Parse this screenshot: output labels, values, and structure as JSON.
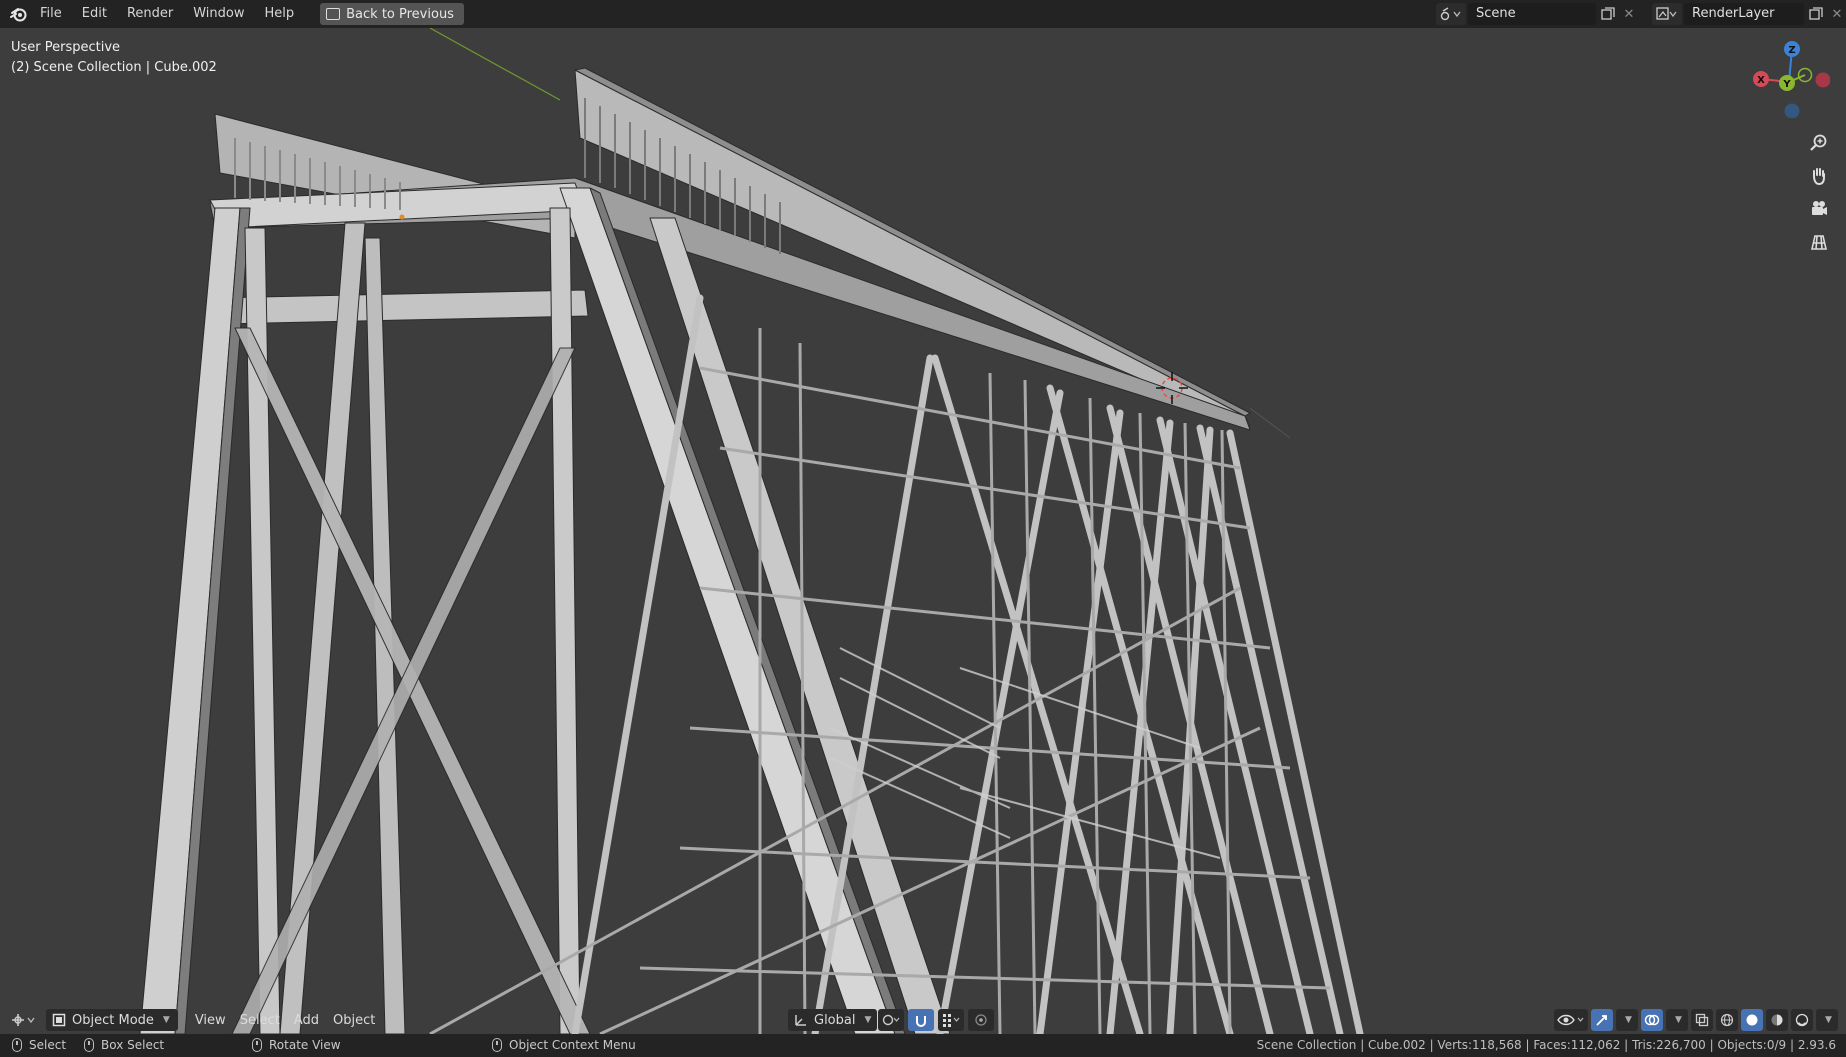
{
  "topbar": {
    "menus": [
      "File",
      "Edit",
      "Render",
      "Window",
      "Help"
    ],
    "back_button": "Back to Previous",
    "scene_name": "Scene",
    "view_layer_name": "RenderLayer"
  },
  "viewport": {
    "perspective_label": "User Perspective",
    "collection_label": "(2) Scene Collection | Cube.002",
    "gizmo": {
      "z": "Z",
      "y": "Y",
      "x": "X"
    }
  },
  "header": {
    "mode": "Object Mode",
    "menus": [
      "View",
      "Select",
      "Add",
      "Object"
    ],
    "orientation": "Global"
  },
  "statusbar": {
    "select": "Select",
    "box_select": "Box Select",
    "rotate_view": "Rotate View",
    "context_menu": "Object Context Menu",
    "stats": "Scene Collection | Cube.002 | Verts:118,568 | Faces:112,062 | Tris:226,700 | Objects:0/9 | 2.93.6"
  },
  "colors": {
    "background": "#3d3d3d",
    "topbar": "#232323",
    "accent_blue": "#4772b3",
    "axis_x": "#d64a57",
    "axis_y": "#8ab730",
    "axis_z": "#3c83d5",
    "steel": "#c9c9c9"
  },
  "icons": [
    "blender-logo-icon",
    "back-icon",
    "scene-icon",
    "copy-icon",
    "close-icon",
    "render-layer-icon",
    "zoom-icon",
    "hand-icon",
    "camera-icon",
    "grid-icon",
    "mode-icon",
    "transform-icon",
    "snap-icon",
    "proportional-icon",
    "overlay-icon",
    "shading-icon"
  ]
}
